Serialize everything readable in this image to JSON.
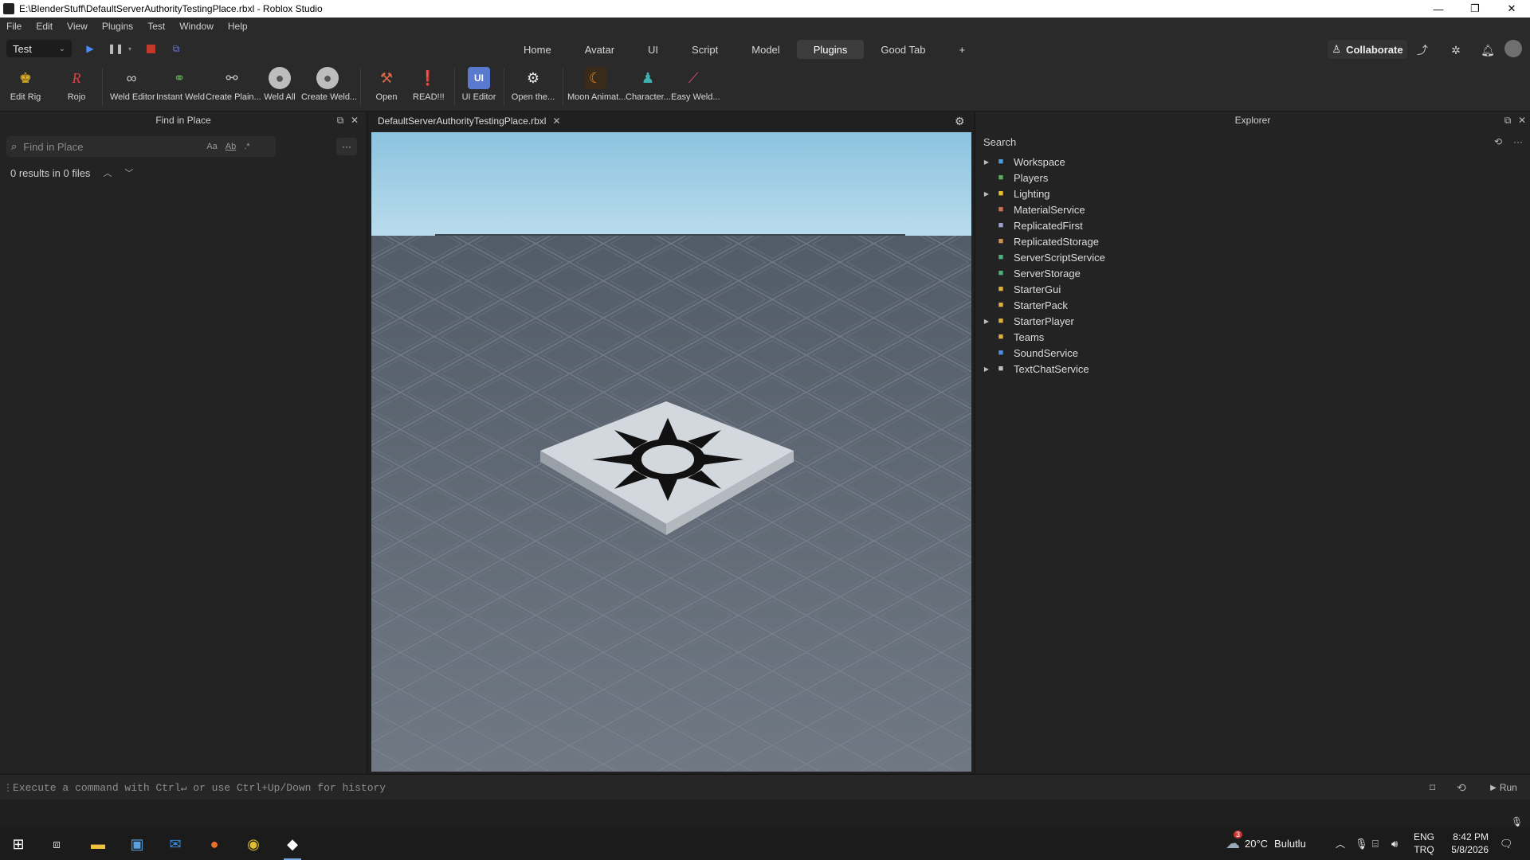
{
  "window": {
    "title": "E:\\BlenderStuff\\DefaultServerAuthorityTestingPlace.rbxl - Roblox Studio",
    "controls": [
      "—",
      "❐",
      "✕"
    ]
  },
  "menu": [
    "File",
    "Edit",
    "View",
    "Plugins",
    "Test",
    "Window",
    "Help"
  ],
  "toolbar": {
    "mode_select": "Test",
    "tabs": [
      "Home",
      "Avatar",
      "UI",
      "Script",
      "Model",
      "Plugins",
      "Good Tab",
      "+"
    ],
    "active_tab": "Plugins",
    "collaborate_label": "Collaborate"
  },
  "ribbon": {
    "buttons": [
      {
        "label": "Edit Rig",
        "icon": "edit-rig-icon",
        "color": "#e0b020"
      },
      {
        "label": "Rojo",
        "icon": "rojo-icon",
        "color": "#e04040"
      },
      {
        "label": "Weld Editor",
        "icon": "weld-editor-icon",
        "color": "#c8c8c8"
      },
      {
        "label": "Instant Weld",
        "icon": "instant-weld-icon",
        "color": "#5aa050"
      },
      {
        "label": "Create Plain...",
        "icon": "create-plain-icon",
        "color": "#c8c8c8"
      },
      {
        "label": "Weld All",
        "icon": "weld-all-icon",
        "color": "#c8c8c8"
      },
      {
        "label": "Create Weld...",
        "icon": "create-weld-icon",
        "color": "#c8c8c8"
      },
      {
        "label": "Open",
        "icon": "open-icon",
        "color": "#d9694a"
      },
      {
        "label": "READ!!!",
        "icon": "read-icon",
        "color": "#d04050"
      },
      {
        "label": "UI Editor",
        "icon": "ui-editor-icon",
        "color": "#5a7ad0"
      },
      {
        "label": "Open the...",
        "icon": "gear-icon",
        "color": "#e8e8e8"
      },
      {
        "label": "Moon Animat...",
        "icon": "moon-animator-icon",
        "color": "#e08020"
      },
      {
        "label": "Character...",
        "icon": "character-icon",
        "color": "#40b0b0"
      },
      {
        "label": "Easy Weld...",
        "icon": "easy-weld-icon",
        "color": "#e05070"
      }
    ]
  },
  "find_panel": {
    "title": "Find in Place",
    "search_placeholder": "Find in Place",
    "opt_case": "Aa",
    "opt_word": "Ab",
    "opt_regex": ".*",
    "results_text": "0 results in 0 files",
    "more_label": "···"
  },
  "viewport": {
    "tab_label": "DefaultServerAuthorityTestingPlace.rbxl"
  },
  "explorer": {
    "title": "Explorer",
    "search_placeholder": "Search",
    "items": [
      {
        "label": "Workspace",
        "expandable": true,
        "icon": "workspace-icon",
        "color": "#4a9ee0"
      },
      {
        "label": "Players",
        "expandable": false,
        "icon": "players-icon",
        "color": "#5ab05a"
      },
      {
        "label": "Lighting",
        "expandable": true,
        "icon": "lighting-icon",
        "color": "#e8c030"
      },
      {
        "label": "MaterialService",
        "expandable": false,
        "icon": "material-service-icon",
        "color": "#d07050"
      },
      {
        "label": "ReplicatedFirst",
        "expandable": false,
        "icon": "replicated-first-icon",
        "color": "#a0a0d0"
      },
      {
        "label": "ReplicatedStorage",
        "expandable": false,
        "icon": "replicated-storage-icon",
        "color": "#d09050"
      },
      {
        "label": "ServerScriptService",
        "expandable": false,
        "icon": "server-script-service-icon",
        "color": "#50b080"
      },
      {
        "label": "ServerStorage",
        "expandable": false,
        "icon": "server-storage-icon",
        "color": "#50b080"
      },
      {
        "label": "StarterGui",
        "expandable": false,
        "icon": "starter-gui-icon",
        "color": "#e0b040"
      },
      {
        "label": "StarterPack",
        "expandable": false,
        "icon": "starter-pack-icon",
        "color": "#e0b040"
      },
      {
        "label": "StarterPlayer",
        "expandable": true,
        "icon": "starter-player-icon",
        "color": "#e0b040"
      },
      {
        "label": "Teams",
        "expandable": false,
        "icon": "teams-icon",
        "color": "#e0b040"
      },
      {
        "label": "SoundService",
        "expandable": false,
        "icon": "sound-service-icon",
        "color": "#5090e0"
      },
      {
        "label": "TextChatService",
        "expandable": true,
        "icon": "text-chat-service-icon",
        "color": "#c0c0c0"
      }
    ]
  },
  "command_bar": {
    "placeholder": "Execute a command with Ctrl↵ or use Ctrl+Up/Down for history",
    "run_label": "Run"
  },
  "taskbar": {
    "weather_temp": "20°C",
    "weather_text": "Bulutlu",
    "lang_line1": "ENG",
    "lang_line2": "TRQ",
    "time": "8:42 PM",
    "date": "5/8/2026",
    "weather_badge": "3"
  }
}
